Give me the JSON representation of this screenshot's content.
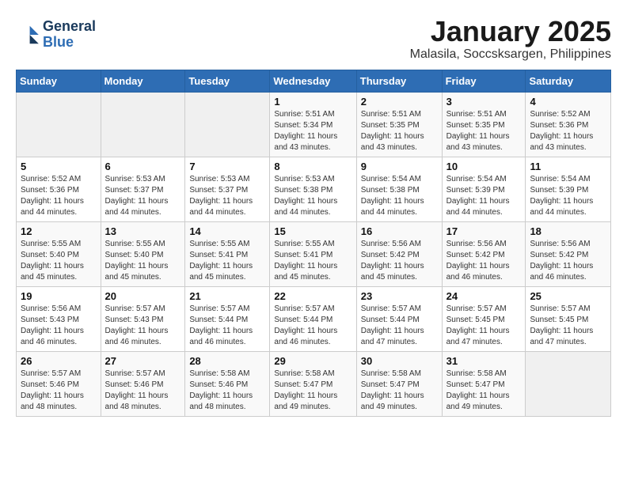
{
  "header": {
    "logo_line1": "General",
    "logo_line2": "Blue",
    "title": "January 2025",
    "subtitle": "Malasila, Soccsksargen, Philippines"
  },
  "weekdays": [
    "Sunday",
    "Monday",
    "Tuesday",
    "Wednesday",
    "Thursday",
    "Friday",
    "Saturday"
  ],
  "weeks": [
    [
      {
        "day": "",
        "sunrise": "",
        "sunset": "",
        "daylight": ""
      },
      {
        "day": "",
        "sunrise": "",
        "sunset": "",
        "daylight": ""
      },
      {
        "day": "",
        "sunrise": "",
        "sunset": "",
        "daylight": ""
      },
      {
        "day": "1",
        "sunrise": "Sunrise: 5:51 AM",
        "sunset": "Sunset: 5:34 PM",
        "daylight": "Daylight: 11 hours and 43 minutes."
      },
      {
        "day": "2",
        "sunrise": "Sunrise: 5:51 AM",
        "sunset": "Sunset: 5:35 PM",
        "daylight": "Daylight: 11 hours and 43 minutes."
      },
      {
        "day": "3",
        "sunrise": "Sunrise: 5:51 AM",
        "sunset": "Sunset: 5:35 PM",
        "daylight": "Daylight: 11 hours and 43 minutes."
      },
      {
        "day": "4",
        "sunrise": "Sunrise: 5:52 AM",
        "sunset": "Sunset: 5:36 PM",
        "daylight": "Daylight: 11 hours and 43 minutes."
      }
    ],
    [
      {
        "day": "5",
        "sunrise": "Sunrise: 5:52 AM",
        "sunset": "Sunset: 5:36 PM",
        "daylight": "Daylight: 11 hours and 44 minutes."
      },
      {
        "day": "6",
        "sunrise": "Sunrise: 5:53 AM",
        "sunset": "Sunset: 5:37 PM",
        "daylight": "Daylight: 11 hours and 44 minutes."
      },
      {
        "day": "7",
        "sunrise": "Sunrise: 5:53 AM",
        "sunset": "Sunset: 5:37 PM",
        "daylight": "Daylight: 11 hours and 44 minutes."
      },
      {
        "day": "8",
        "sunrise": "Sunrise: 5:53 AM",
        "sunset": "Sunset: 5:38 PM",
        "daylight": "Daylight: 11 hours and 44 minutes."
      },
      {
        "day": "9",
        "sunrise": "Sunrise: 5:54 AM",
        "sunset": "Sunset: 5:38 PM",
        "daylight": "Daylight: 11 hours and 44 minutes."
      },
      {
        "day": "10",
        "sunrise": "Sunrise: 5:54 AM",
        "sunset": "Sunset: 5:39 PM",
        "daylight": "Daylight: 11 hours and 44 minutes."
      },
      {
        "day": "11",
        "sunrise": "Sunrise: 5:54 AM",
        "sunset": "Sunset: 5:39 PM",
        "daylight": "Daylight: 11 hours and 44 minutes."
      }
    ],
    [
      {
        "day": "12",
        "sunrise": "Sunrise: 5:55 AM",
        "sunset": "Sunset: 5:40 PM",
        "daylight": "Daylight: 11 hours and 45 minutes."
      },
      {
        "day": "13",
        "sunrise": "Sunrise: 5:55 AM",
        "sunset": "Sunset: 5:40 PM",
        "daylight": "Daylight: 11 hours and 45 minutes."
      },
      {
        "day": "14",
        "sunrise": "Sunrise: 5:55 AM",
        "sunset": "Sunset: 5:41 PM",
        "daylight": "Daylight: 11 hours and 45 minutes."
      },
      {
        "day": "15",
        "sunrise": "Sunrise: 5:55 AM",
        "sunset": "Sunset: 5:41 PM",
        "daylight": "Daylight: 11 hours and 45 minutes."
      },
      {
        "day": "16",
        "sunrise": "Sunrise: 5:56 AM",
        "sunset": "Sunset: 5:42 PM",
        "daylight": "Daylight: 11 hours and 45 minutes."
      },
      {
        "day": "17",
        "sunrise": "Sunrise: 5:56 AM",
        "sunset": "Sunset: 5:42 PM",
        "daylight": "Daylight: 11 hours and 46 minutes."
      },
      {
        "day": "18",
        "sunrise": "Sunrise: 5:56 AM",
        "sunset": "Sunset: 5:42 PM",
        "daylight": "Daylight: 11 hours and 46 minutes."
      }
    ],
    [
      {
        "day": "19",
        "sunrise": "Sunrise: 5:56 AM",
        "sunset": "Sunset: 5:43 PM",
        "daylight": "Daylight: 11 hours and 46 minutes."
      },
      {
        "day": "20",
        "sunrise": "Sunrise: 5:57 AM",
        "sunset": "Sunset: 5:43 PM",
        "daylight": "Daylight: 11 hours and 46 minutes."
      },
      {
        "day": "21",
        "sunrise": "Sunrise: 5:57 AM",
        "sunset": "Sunset: 5:44 PM",
        "daylight": "Daylight: 11 hours and 46 minutes."
      },
      {
        "day": "22",
        "sunrise": "Sunrise: 5:57 AM",
        "sunset": "Sunset: 5:44 PM",
        "daylight": "Daylight: 11 hours and 46 minutes."
      },
      {
        "day": "23",
        "sunrise": "Sunrise: 5:57 AM",
        "sunset": "Sunset: 5:44 PM",
        "daylight": "Daylight: 11 hours and 47 minutes."
      },
      {
        "day": "24",
        "sunrise": "Sunrise: 5:57 AM",
        "sunset": "Sunset: 5:45 PM",
        "daylight": "Daylight: 11 hours and 47 minutes."
      },
      {
        "day": "25",
        "sunrise": "Sunrise: 5:57 AM",
        "sunset": "Sunset: 5:45 PM",
        "daylight": "Daylight: 11 hours and 47 minutes."
      }
    ],
    [
      {
        "day": "26",
        "sunrise": "Sunrise: 5:57 AM",
        "sunset": "Sunset: 5:46 PM",
        "daylight": "Daylight: 11 hours and 48 minutes."
      },
      {
        "day": "27",
        "sunrise": "Sunrise: 5:57 AM",
        "sunset": "Sunset: 5:46 PM",
        "daylight": "Daylight: 11 hours and 48 minutes."
      },
      {
        "day": "28",
        "sunrise": "Sunrise: 5:58 AM",
        "sunset": "Sunset: 5:46 PM",
        "daylight": "Daylight: 11 hours and 48 minutes."
      },
      {
        "day": "29",
        "sunrise": "Sunrise: 5:58 AM",
        "sunset": "Sunset: 5:47 PM",
        "daylight": "Daylight: 11 hours and 49 minutes."
      },
      {
        "day": "30",
        "sunrise": "Sunrise: 5:58 AM",
        "sunset": "Sunset: 5:47 PM",
        "daylight": "Daylight: 11 hours and 49 minutes."
      },
      {
        "day": "31",
        "sunrise": "Sunrise: 5:58 AM",
        "sunset": "Sunset: 5:47 PM",
        "daylight": "Daylight: 11 hours and 49 minutes."
      },
      {
        "day": "",
        "sunrise": "",
        "sunset": "",
        "daylight": ""
      }
    ]
  ]
}
